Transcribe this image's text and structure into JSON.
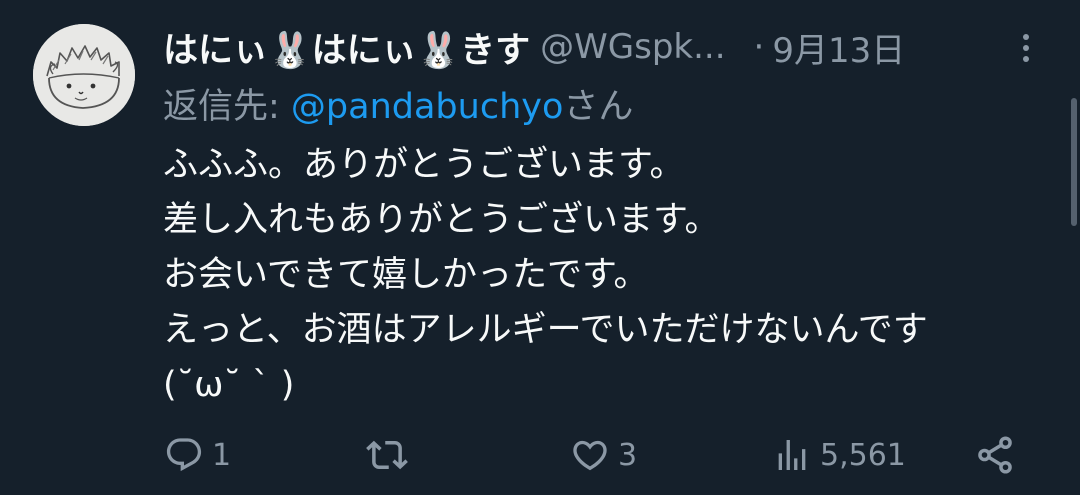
{
  "tweet": {
    "display_name": "はにぃ🐰はにぃ🐰きす",
    "handle": "@WGspk...",
    "separator": "·",
    "date": "9月13日",
    "reply_prefix": "返信先: ",
    "reply_mention": "@pandabuchyo",
    "reply_suffix": "さん",
    "body": "ふふふ。ありがとうございます。\n差し入れもありがとうございます。\nお会いできて嬉しかったです。\nえっと、お酒はアレルギーでいただけないんです\n(˘ω˘ ` )"
  },
  "actions": {
    "reply_count": "1",
    "retweet_count": "",
    "like_count": "3",
    "views_count": "5,561"
  },
  "icons": {
    "reply": "reply-icon",
    "retweet": "retweet-icon",
    "like": "heart-icon",
    "views": "views-bar-chart-icon",
    "share": "share-icon",
    "more": "more-vertical-icon"
  },
  "colors": {
    "background": "#15202b",
    "text_primary": "#f7f9f9",
    "text_secondary": "#8b98a5",
    "link": "#1d9bf0"
  }
}
